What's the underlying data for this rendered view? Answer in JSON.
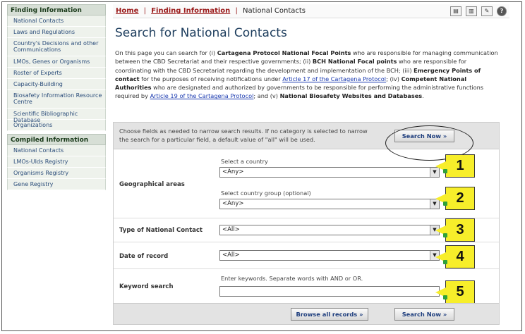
{
  "sidebar": {
    "section1_title": "Finding Information",
    "section1_items": [
      "National Contacts",
      "Laws and Regulations",
      "Country's Decisions and other Communications",
      "LMOs, Genes or Organisms",
      "Roster of Experts",
      "Capacity-Building",
      "Biosafety Information Resource Centre",
      "Scientific Bibliographic Database",
      "Organizations"
    ],
    "section2_title": "Compiled Information",
    "section2_items": [
      "National Contacts",
      "LMOs-UIds Registry",
      "Organisms Registry",
      "Gene Registry"
    ]
  },
  "breadcrumb": {
    "home": "Home",
    "separator": "|",
    "finding": "Finding Information",
    "current": "National Contacts"
  },
  "toolbar_icons": [
    "print-icon",
    "search-doc-icon",
    "tools-icon",
    "help-icon"
  ],
  "page_title": "Search for National Contacts",
  "intro": {
    "p1": "On this page you can search for (i) ",
    "b1": "Cartagena Protocol National Focal Points",
    "p2": " who are responsible for managing communication between the CBD Secretariat and their respective governments; (ii) ",
    "b2": "BCH National Focal points",
    "p3": " who are responsible for coordinating with the CBD Secretariat regarding the development and implementation of the BCH; (iii) ",
    "b3": "Emergency Points of contact",
    "p4": " for the purposes of receiving notifications under ",
    "link1": "Article 17 of the Cartagena Protocol",
    "p5": "; (iv) ",
    "b4": "Competent National Authorities",
    "p6": " who are designated and authorized by governments to be responsible for performing the administrative functions required by ",
    "link2": "Article 19 of the Cartagena Protocol",
    "p7": "; and (v) ",
    "b5": "National Biosafety Websites and Databases",
    "p8": "."
  },
  "form": {
    "help_text": "Choose fields as needed to narrow search results. If no category is selected to narrow the search for a particular field, a default value of \"all\" will be used.",
    "search_now_label": "Search Now »",
    "geo_label": "Geographical areas",
    "country_label": "Select a country",
    "country_value": "<Any>",
    "group_label": "Select country group (optional)",
    "group_value": "<Any>",
    "type_label": "Type of National Contact",
    "type_value": "<All>",
    "date_label": "Date of record",
    "date_value": "<All>",
    "keyword_label": "Keyword search",
    "keyword_hint": "Enter keywords. Separate words with AND or OR.",
    "keyword_value": "",
    "browse_label": "Browse all records »",
    "search_bottom_label": "Search Now »"
  },
  "callouts": [
    "1",
    "2",
    "3",
    "4",
    "5"
  ],
  "colors": {
    "callout_fill": "#f7ee2a",
    "title_blue": "#1d3d5d",
    "crumb_red": "#9a1a1a",
    "link_blue": "#1a3ab0"
  }
}
